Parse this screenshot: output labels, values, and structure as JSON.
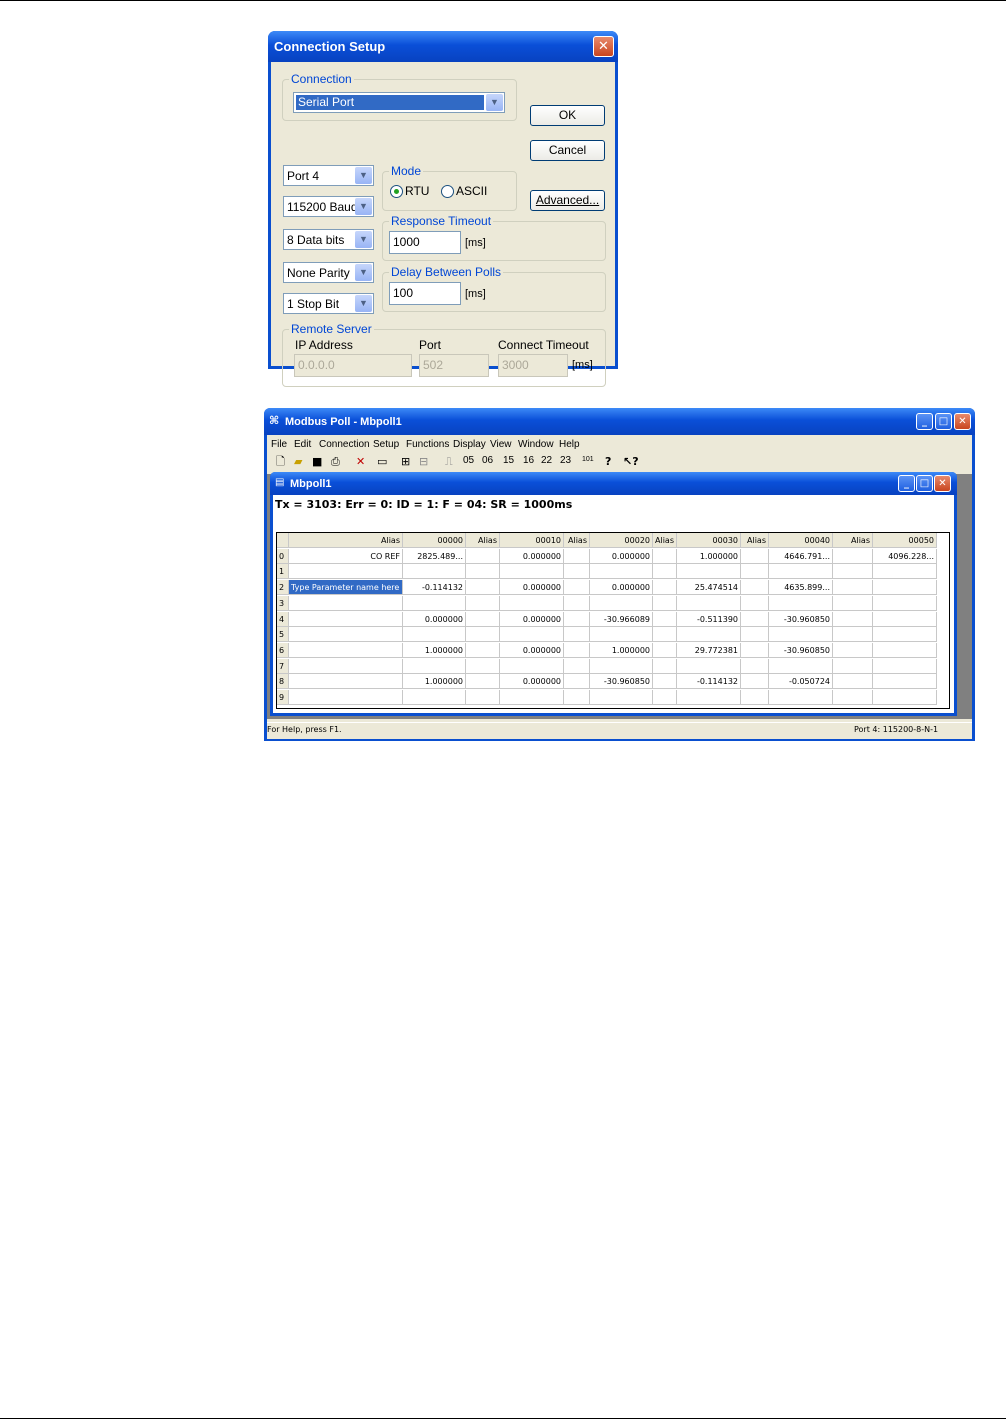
{
  "connection_dialog": {
    "title": "Connection Setup",
    "close_icon": "close-icon",
    "connection_group_label": "Connection",
    "connection_value": "Serial Port",
    "ok_label": "OK",
    "cancel_label": "Cancel",
    "advanced_label": "Advanced...",
    "port_value": "Port 4",
    "baud_value": "115200 Baud",
    "databits_value": "8 Data bits",
    "parity_value": "None Parity",
    "stopbit_value": "1 Stop Bit",
    "mode_label": "Mode",
    "mode_rtu": "RTU",
    "mode_ascii": "ASCII",
    "mode_selected": "RTU",
    "response_timeout_label": "Response Timeout",
    "response_timeout_value": "1000",
    "ms_unit": "[ms]",
    "delay_label": "Delay Between Polls",
    "delay_value": "100",
    "remote_server_label": "Remote Server",
    "ip_label": "IP Address",
    "ip_value": "0.0.0.0",
    "port_label": "Port",
    "port_num_value": "502",
    "connect_timeout_label": "Connect Timeout",
    "connect_timeout_value": "3000"
  },
  "modbus_window": {
    "title": "Modbus Poll - Mbpoll1",
    "menu": [
      "File",
      "Edit",
      "Connection",
      "Setup",
      "Functions",
      "Display",
      "View",
      "Window",
      "Help"
    ],
    "toolbar_codes": [
      "05",
      "06",
      "15",
      "16",
      "22",
      "23",
      "101"
    ],
    "child": {
      "title": "Mbpoll1",
      "status": "Tx = 3103: Err = 0: ID = 1: F = 04: SR = 1000ms",
      "headers": [
        "Alias",
        "00000",
        "Alias",
        "00010",
        "Alias",
        "00020",
        "Alias",
        "00030",
        "Alias",
        "00040",
        "Alias",
        "00050"
      ],
      "rows": [
        [
          "0",
          "CO REF",
          "2825.489...",
          "",
          "0.000000",
          "",
          "0.000000",
          "",
          "1.000000",
          "",
          "4646.791...",
          "",
          "4096.228..."
        ],
        [
          "1",
          "",
          "",
          "",
          "",
          "",
          "",
          "",
          "",
          "",
          "",
          "",
          ""
        ],
        [
          "2",
          "Type Parameter name here",
          "-0.114132",
          "",
          "0.000000",
          "",
          "0.000000",
          "",
          "25.474514",
          "",
          "4635.899...",
          "",
          ""
        ],
        [
          "3",
          "",
          "",
          "",
          "",
          "",
          "",
          "",
          "",
          "",
          "",
          "",
          ""
        ],
        [
          "4",
          "",
          "0.000000",
          "",
          "0.000000",
          "",
          "-30.966089",
          "",
          "-0.511390",
          "",
          "-30.960850",
          "",
          ""
        ],
        [
          "5",
          "",
          "",
          "",
          "",
          "",
          "",
          "",
          "",
          "",
          "",
          "",
          ""
        ],
        [
          "6",
          "",
          "1.000000",
          "",
          "0.000000",
          "",
          "1.000000",
          "",
          "29.772381",
          "",
          "-30.960850",
          "",
          ""
        ],
        [
          "7",
          "",
          "",
          "",
          "",
          "",
          "",
          "",
          "",
          "",
          "",
          "",
          ""
        ],
        [
          "8",
          "",
          "1.000000",
          "",
          "0.000000",
          "",
          "-30.960850",
          "",
          "-0.114132",
          "",
          "-0.050724",
          "",
          ""
        ],
        [
          "9",
          "",
          "",
          "",
          "",
          "",
          "",
          "",
          "",
          "",
          "",
          "",
          ""
        ]
      ]
    },
    "statusbar_left": "For Help, press F1.",
    "statusbar_right": "Port 4: 115200-8-N-1"
  },
  "colors": {
    "titlebar": "#0a4fd8",
    "dialog_face": "#ece9d8",
    "selection": "#316ac5",
    "group_label": "#0046d5"
  }
}
